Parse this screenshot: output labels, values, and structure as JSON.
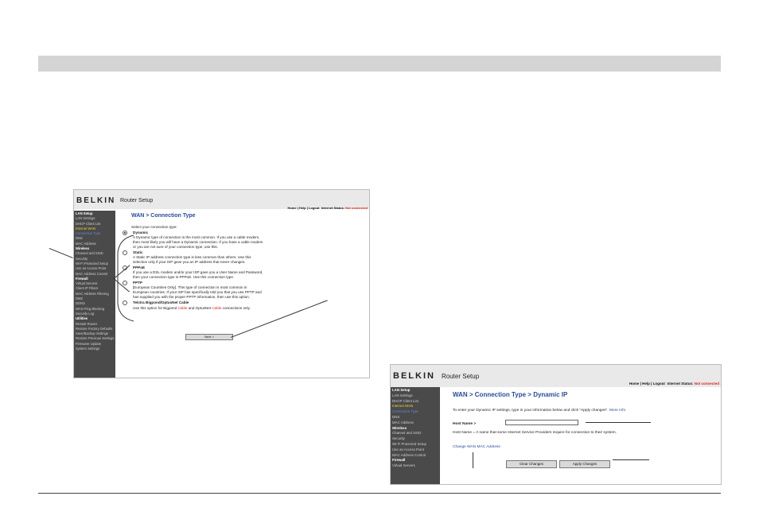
{
  "screenshot1": {
    "brand": "BELKIN",
    "app_title": "Router Setup",
    "nav": {
      "home": "Home",
      "help": "Help",
      "logout": "Logout",
      "status_label": "Internet Status:",
      "status_value": "Not connected"
    },
    "sidebar": [
      {
        "label": "LAN Setup",
        "type": "heading"
      },
      {
        "label": "LAN Settings",
        "type": "item"
      },
      {
        "label": "DHCP Client List",
        "type": "item"
      },
      {
        "label": "Internet WAN",
        "type": "active"
      },
      {
        "label": "Connection Type",
        "type": "selected"
      },
      {
        "label": "DNS",
        "type": "item"
      },
      {
        "label": "MAC Address",
        "type": "item"
      },
      {
        "label": "Wireless",
        "type": "heading"
      },
      {
        "label": "Channel and SSID",
        "type": "item"
      },
      {
        "label": "Security",
        "type": "item"
      },
      {
        "label": "Wi-Fi Protected Setup",
        "type": "item"
      },
      {
        "label": "Use as Access Point",
        "type": "item"
      },
      {
        "label": "MAC Address Control",
        "type": "item"
      },
      {
        "label": "Firewall",
        "type": "heading"
      },
      {
        "label": "Virtual Servers",
        "type": "item"
      },
      {
        "label": "Client IP Filters",
        "type": "item"
      },
      {
        "label": "MAC Address Filtering",
        "type": "item"
      },
      {
        "label": "DMZ",
        "type": "item"
      },
      {
        "label": "DDNS",
        "type": "item"
      },
      {
        "label": "WAN Ping Blocking",
        "type": "item"
      },
      {
        "label": "Security Log",
        "type": "item"
      },
      {
        "label": "Utilities",
        "type": "heading"
      },
      {
        "label": "Restart Router",
        "type": "item"
      },
      {
        "label": "Restore Factory Defaults",
        "type": "item"
      },
      {
        "label": "Save/Backup Settings",
        "type": "item"
      },
      {
        "label": "Restore Previous Settings",
        "type": "item"
      },
      {
        "label": "Firmware Update",
        "type": "item"
      },
      {
        "label": "System Settings",
        "type": "item"
      }
    ],
    "page_title": "WAN > Connection Type",
    "prompt": "Select your connection type:",
    "options": [
      {
        "name": "Dynamic",
        "selected": true,
        "desc1": "A Dynamic type of connection is the most common. If you use a cable modem,",
        "desc2": "then most likely you will have a Dynamic connection. If you have a cable modem",
        "desc3": "or you are not sure of your connection type, use this."
      },
      {
        "name": "Static",
        "selected": false,
        "desc1": "A Static IP address connection type is less common than others. Use this",
        "desc2": "selection only if your ISP gave you an IP address that never changes.",
        "desc3": ""
      },
      {
        "name": "PPPoE",
        "selected": false,
        "desc1": "If you use a DSL modem and/or your ISP gave you a User Name and Password,",
        "desc2": "then your connection type is PPPoE. Use this connection type.",
        "desc3": ""
      },
      {
        "name": "PPTP",
        "selected": false,
        "desc1": "[European Countries Only]. This type of connection is most common in",
        "desc2": "European countries. If your ISP has specifically told you that you use PPTP and",
        "desc3": "has supplied you with the proper PPTP information, then use this option."
      },
      {
        "name": "Telstra Bigpond/OptusNet Cable",
        "selected": false,
        "desc1": "",
        "desc2": "",
        "desc3": ""
      }
    ],
    "telstra": {
      "pre": "Use this option for Bigpond ",
      "cable1": "Cable",
      "mid": " and OptusNet ",
      "cable2": "Cable",
      "post": " connections only."
    },
    "next_button": "Next >"
  },
  "screenshot2": {
    "brand": "BELKIN",
    "app_title": "Router Setup",
    "nav": {
      "home": "Home",
      "help": "Help",
      "logout": "Logout",
      "status_label": "Internet Status:",
      "status_value": "Not connected"
    },
    "sidebar": [
      {
        "label": "LAN Setup",
        "type": "heading"
      },
      {
        "label": "LAN Settings",
        "type": "item"
      },
      {
        "label": "DHCP Client List",
        "type": "item"
      },
      {
        "label": "Internet WAN",
        "type": "active"
      },
      {
        "label": "Connection Type",
        "type": "selected"
      },
      {
        "label": "DNS",
        "type": "item"
      },
      {
        "label": "MAC Address",
        "type": "item"
      },
      {
        "label": "Wireless",
        "type": "heading"
      },
      {
        "label": "Channel and SSID",
        "type": "item"
      },
      {
        "label": "Security",
        "type": "item"
      },
      {
        "label": "Wi-Fi Protected Setup",
        "type": "item"
      },
      {
        "label": "Use as Access Point",
        "type": "item"
      },
      {
        "label": "MAC Address Control",
        "type": "item"
      },
      {
        "label": "Firewall",
        "type": "heading"
      },
      {
        "label": "Virtual Servers",
        "type": "item"
      }
    ],
    "page_title": "WAN > Connection Type > Dynamic IP",
    "instructions": "To enter your Dynamic IP settings, type in your information below and click \"Apply changes\".",
    "more_info": "More Info",
    "host_name_label": "Host Name >",
    "host_name_value": "",
    "host_name_note": "Host Name = A name that some Internet Service Providers require for connection to their system.",
    "change_mac_link": "Change WAN MAC Address",
    "clear_button": "Clear Changes",
    "apply_button": "Apply Changes"
  }
}
